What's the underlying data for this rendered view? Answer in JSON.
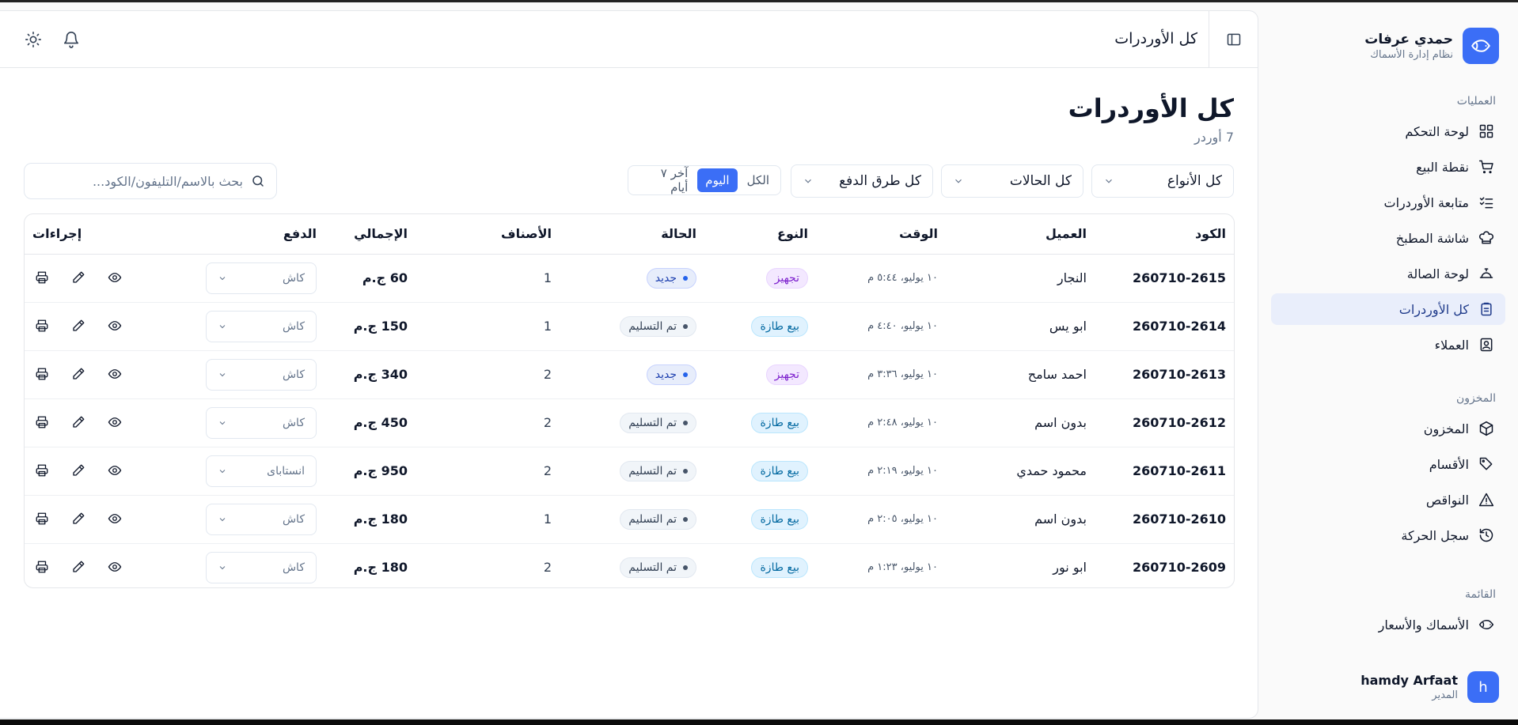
{
  "brand": {
    "name": "حمدي عرفات",
    "subtitle": "نظام إدارة الأسماك",
    "logo_icon": "fish-icon"
  },
  "nav": {
    "groups": [
      {
        "label": "العمليات",
        "items": [
          {
            "label": "لوحة التحكم",
            "icon": "grid-icon"
          },
          {
            "label": "نقطة البيع",
            "icon": "cart-icon"
          },
          {
            "label": "متابعة الأوردرات",
            "icon": "list-check-icon"
          },
          {
            "label": "شاشة المطبخ",
            "icon": "chef-hat-icon"
          },
          {
            "label": "لوحة الصالة",
            "icon": "bell-service-icon"
          },
          {
            "label": "كل الأوردرات",
            "icon": "clipboard-icon",
            "active": true
          },
          {
            "label": "العملاء",
            "icon": "contact-icon"
          }
        ]
      },
      {
        "label": "المخزون",
        "items": [
          {
            "label": "المخزون",
            "icon": "box-icon"
          },
          {
            "label": "الأقسام",
            "icon": "tag-icon"
          },
          {
            "label": "النواقص",
            "icon": "warning-icon"
          },
          {
            "label": "سجل الحركة",
            "icon": "history-icon"
          }
        ]
      },
      {
        "label": "القائمة",
        "items": [
          {
            "label": "الأسماك والأسعار",
            "icon": "fish-icon"
          }
        ]
      }
    ]
  },
  "user": {
    "initial": "h",
    "name": "hamdy Arfaat",
    "role": "المدير"
  },
  "topbar": {
    "title": "كل الأوردرات"
  },
  "page": {
    "title": "كل الأوردرات",
    "count": "7 أوردر"
  },
  "filters": {
    "type": "كل الأنواع",
    "status": "كل الحالات",
    "payment": "كل طرق الدفع",
    "range": {
      "options": [
        "الكل",
        "اليوم",
        "آخر ٧ أيام"
      ],
      "active": 1
    },
    "search_placeholder": "بحث بالاسم/التليفون/الكود..."
  },
  "table": {
    "headers": {
      "code": "الكود",
      "customer": "العميل",
      "time": "الوقت",
      "type": "النوع",
      "status": "الحالة",
      "items": "الأصناف",
      "total": "الإجمالي",
      "payment": "الدفع",
      "actions": "إجراءات"
    },
    "rows": [
      {
        "code": "260710-2615",
        "customer": "النجار",
        "time": "١٠ يوليو، ٥:٤٤ م",
        "type": "تجهيز",
        "type_kind": "prep",
        "status": "جديد",
        "status_kind": "new",
        "items": "1",
        "total": "60 ج.م",
        "payment": "كاش"
      },
      {
        "code": "260710-2614",
        "customer": "ابو يس",
        "time": "١٠ يوليو، ٤:٤٠ م",
        "type": "بيع طازة",
        "type_kind": "fresh",
        "status": "تم التسليم",
        "status_kind": "done",
        "items": "1",
        "total": "150 ج.م",
        "payment": "كاش"
      },
      {
        "code": "260710-2613",
        "customer": "احمد سامح",
        "time": "١٠ يوليو، ٣:٣٦ م",
        "type": "تجهيز",
        "type_kind": "prep",
        "status": "جديد",
        "status_kind": "new",
        "items": "2",
        "total": "340 ج.م",
        "payment": "كاش"
      },
      {
        "code": "260710-2612",
        "customer": "بدون اسم",
        "time": "١٠ يوليو، ٢:٤٨ م",
        "type": "بيع طازة",
        "type_kind": "fresh",
        "status": "تم التسليم",
        "status_kind": "done",
        "items": "2",
        "total": "450 ج.م",
        "payment": "كاش"
      },
      {
        "code": "260710-2611",
        "customer": "محمود حمدي",
        "time": "١٠ يوليو، ٢:١٩ م",
        "type": "بيع طازة",
        "type_kind": "fresh",
        "status": "تم التسليم",
        "status_kind": "done",
        "items": "2",
        "total": "950 ج.م",
        "payment": "انستاباى"
      },
      {
        "code": "260710-2610",
        "customer": "بدون اسم",
        "time": "١٠ يوليو، ٢:٠٥ م",
        "type": "بيع طازة",
        "type_kind": "fresh",
        "status": "تم التسليم",
        "status_kind": "done",
        "items": "1",
        "total": "180 ج.م",
        "payment": "كاش"
      },
      {
        "code": "260710-2609",
        "customer": "ابو نور",
        "time": "١٠ يوليو، ١:٢٣ م",
        "type": "بيع طازة",
        "type_kind": "fresh",
        "status": "تم التسليم",
        "status_kind": "done",
        "items": "2",
        "total": "180 ج.م",
        "payment": "كاش"
      }
    ]
  },
  "colors": {
    "accent": "#3b6ef6",
    "active_nav_bg": "#e9eefb"
  }
}
